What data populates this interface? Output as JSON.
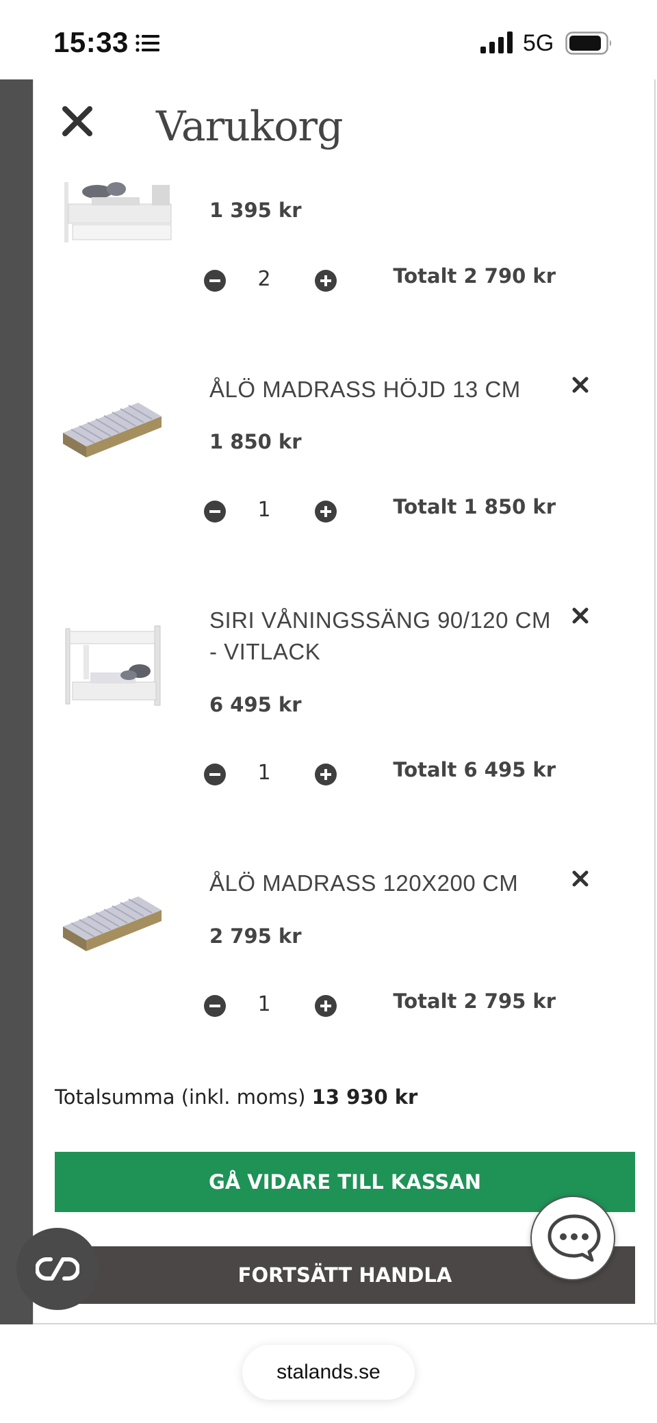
{
  "status_bar": {
    "time": "15:33",
    "network": "5G",
    "list_icon": "list-icon",
    "signal_icon": "signal-icon",
    "battery_icon": "battery-icon"
  },
  "cart": {
    "title": "Varukorg",
    "close_icon": "close-icon",
    "items": [
      {
        "name": "",
        "price": "1 395 kr",
        "qty": "2",
        "total": "Totalt 2 790 kr",
        "image_icon": "bed-image"
      },
      {
        "name": "ÅLÖ MADRASS HÖJD 13 CM",
        "price": "1 850 kr",
        "qty": "1",
        "total": "Totalt 1 850 kr",
        "image_icon": "mattress-image"
      },
      {
        "name": "SIRI VÅNINGSSÄNG 90/120 CM - VITLACK",
        "price": "6 495 kr",
        "qty": "1",
        "total": "Totalt 6 495 kr",
        "image_icon": "bunk-bed-image"
      },
      {
        "name": "ÅLÖ MADRASS 120X200 CM",
        "price": "2 795 kr",
        "qty": "1",
        "total": "Totalt 2 795 kr",
        "image_icon": "mattress-image"
      }
    ],
    "grand_total_label": "Totalsumma (inkl. moms)",
    "grand_total_value": "13 930 kr",
    "checkout_label": "GÅ VIDARE TILL KASSAN",
    "continue_label": "FORTSÄTT HANDLA"
  },
  "colors": {
    "checkout_green": "#1f9256",
    "continue_dark": "#4a4746",
    "overlay_dark": "#505050"
  },
  "browser": {
    "url": "stalands.se"
  }
}
